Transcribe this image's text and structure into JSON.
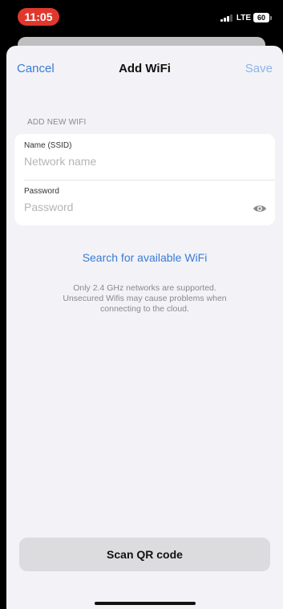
{
  "status_bar": {
    "time": "11:05",
    "network": "LTE",
    "battery": "60",
    "pill_color": "#e0382c"
  },
  "nav": {
    "cancel_label": "Cancel",
    "title": "Add WiFi",
    "save_label": "Save"
  },
  "form": {
    "section_header": "ADD NEW WIFI",
    "name_label": "Name (SSID)",
    "name_placeholder": "Network name",
    "name_value": "",
    "password_label": "Password",
    "password_placeholder": "Password",
    "password_value": "",
    "password_toggle_icon": "eye-icon"
  },
  "search_link": "Search for available WiFi",
  "info_lines": [
    "Only 2.4 GHz networks are supported.",
    "Unsecured Wifis may cause problems when",
    "connecting to the cloud."
  ],
  "scan_button_label": "Scan QR code",
  "colors": {
    "accent": "#3a7bd5",
    "accent_disabled": "#8fb4e8",
    "background": "#f2f2f7"
  }
}
